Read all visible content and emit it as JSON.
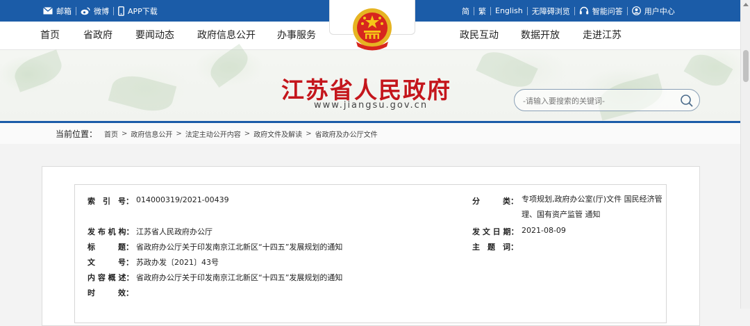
{
  "topbar": {
    "mail": "邮箱",
    "weibo": "微博",
    "app": "APP下载",
    "simplified": "简",
    "traditional": "繁",
    "english": "English",
    "accessible": "无障碍浏览",
    "smart_qa": "智能问答",
    "user_center": "用户中心"
  },
  "nav": {
    "home": "首页",
    "province": "省政府",
    "news": "要闻动态",
    "info": "政府信息公开",
    "service": "办事服务",
    "interaction": "政民互动",
    "open_data": "数据开放",
    "about": "走进江苏"
  },
  "banner": {
    "title": "江苏省人民政府",
    "url": "www.jiangsu.gov.cn"
  },
  "search": {
    "placeholder": "-请输入要搜索的关键词-"
  },
  "breadcrumb": {
    "lead": "当前位置：",
    "items": [
      "首页",
      "政府信息公开",
      "法定主动公开内容",
      "政府文件及解读",
      "省政府及办公厅文件"
    ]
  },
  "meta": {
    "index_label": "索　引　号：",
    "index_value": "014000319/2021-00439",
    "category_label": "分　　　类：",
    "category_value": "专项规划,政府办公室(厅)文件 国民经济管理、国有资产监管 通知",
    "publisher_label": "发 布 机 构：",
    "publisher_value": "江苏省人民政府办公厅",
    "date_label": "发 文 日 期：",
    "date_value": "2021-08-09",
    "title_label": "标　　　题：",
    "title_value": "省政府办公厅关于印发南京江北新区“十四五”发展规划的通知",
    "subject_label": "主　题　词：",
    "subject_value": "",
    "docno_label": "文　　　号：",
    "docno_value": "苏政办发〔2021〕43号",
    "summary_label": "内 容 概 述：",
    "summary_value": "省政府办公厅关于印发南京江北新区“十四五”发展规划的通知",
    "validity_label": "时　　　效：",
    "validity_value": ""
  },
  "colors": {
    "brand_blue": "#1b5ca8",
    "title_red": "#c4161c"
  }
}
